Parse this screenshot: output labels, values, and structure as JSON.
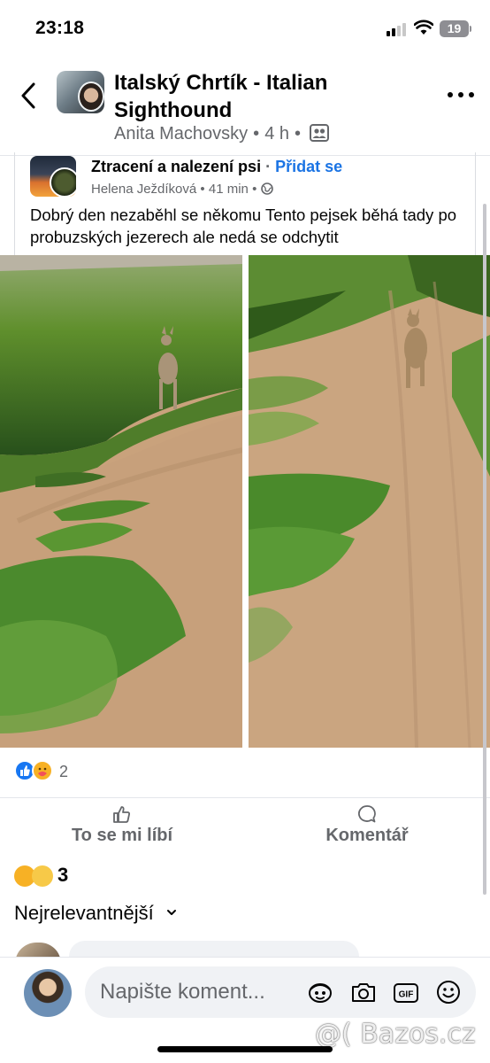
{
  "status_bar": {
    "time": "23:18",
    "battery": "19"
  },
  "group": {
    "title": "Italský Chrtík - Italian Sighthound",
    "author": "Anita Machovsky",
    "age": "4 h",
    "separator": "•"
  },
  "shared_post": {
    "group_name": "Ztracení a nalezení psi",
    "join_label": "Přidat se",
    "separator": "·",
    "author": "Helena Ježdíková",
    "age": "41 min",
    "text": "Dobrý den nezaběhl se někomu Tento pejsek běhá tady po probuzských jezerech ale nedá se odchytit"
  },
  "reactions": {
    "count": "2",
    "types": [
      "like",
      "care"
    ]
  },
  "actions": {
    "like_label": "To se mi líbí",
    "comment_label": "Komentář"
  },
  "comment_reactions": {
    "count": "3"
  },
  "sort": {
    "label": "Nejrelevantnější"
  },
  "composer": {
    "placeholder": "Napište koment..."
  },
  "watermark": "@( Bazos.cz",
  "colors": {
    "link": "#1b74e4",
    "secondary_text": "#65676b",
    "like_blue": "#1877f2",
    "divider": "#e4e6eb",
    "input_bg": "#f0f2f5"
  },
  "icons": [
    "back-chevron",
    "more-dots",
    "members-icon",
    "globe-icon",
    "thumbs-up-icon",
    "comment-bubble-icon",
    "avatar-face-sticker-icon",
    "camera-icon",
    "gif-icon",
    "smiley-icon"
  ]
}
